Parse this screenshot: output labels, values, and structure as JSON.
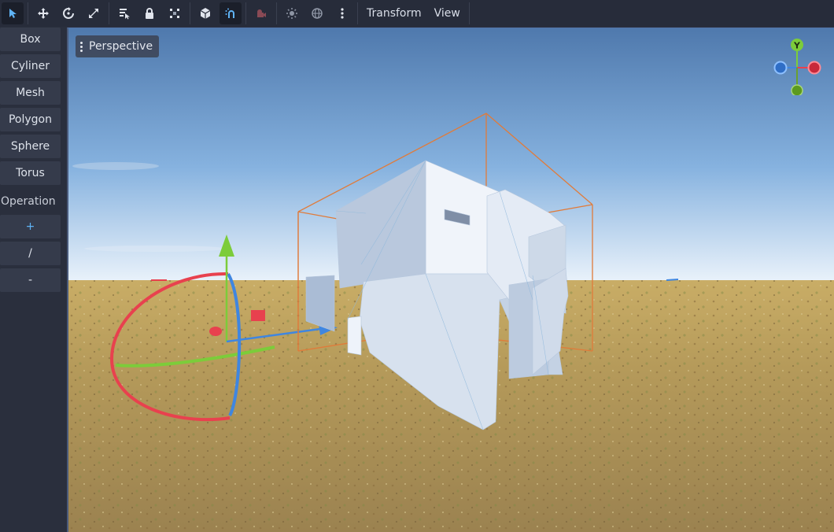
{
  "toolbar": {
    "tools": [
      {
        "icon": "select-arrow-icon",
        "active": true
      },
      {
        "icon": "move-icon"
      },
      {
        "icon": "rotate-icon"
      },
      {
        "icon": "scale-icon"
      },
      {
        "icon": "list-select-icon"
      },
      {
        "icon": "lock-icon"
      },
      {
        "icon": "group-icon"
      },
      {
        "icon": "local-space-icon"
      },
      {
        "icon": "snap-icon",
        "active": true
      },
      {
        "icon": "camera-preview-icon"
      },
      {
        "icon": "sun-icon"
      },
      {
        "icon": "environment-globe-icon"
      },
      {
        "icon": "more-vertical-icon"
      }
    ],
    "menus": {
      "transform": "Transform",
      "view": "View"
    }
  },
  "sidebar": {
    "shapes": [
      "Box",
      "Cyliner",
      "Mesh",
      "Polygon",
      "Sphere",
      "Torus"
    ],
    "operation_label": "Operation",
    "operations": [
      "+",
      "/",
      "-"
    ]
  },
  "viewport": {
    "camera_label": "Perspective",
    "gizmo_axes": {
      "y": "Y"
    },
    "colors": {
      "sky_top": "#4f79ad",
      "sky_horizon": "#e8f1fa",
      "ground": "#b59a5a",
      "bbox": "#e07b3a",
      "mesh": "#dde6f2",
      "axis_x": "#e8414e",
      "axis_y": "#7ccc3a",
      "axis_z": "#3f86e0"
    }
  }
}
